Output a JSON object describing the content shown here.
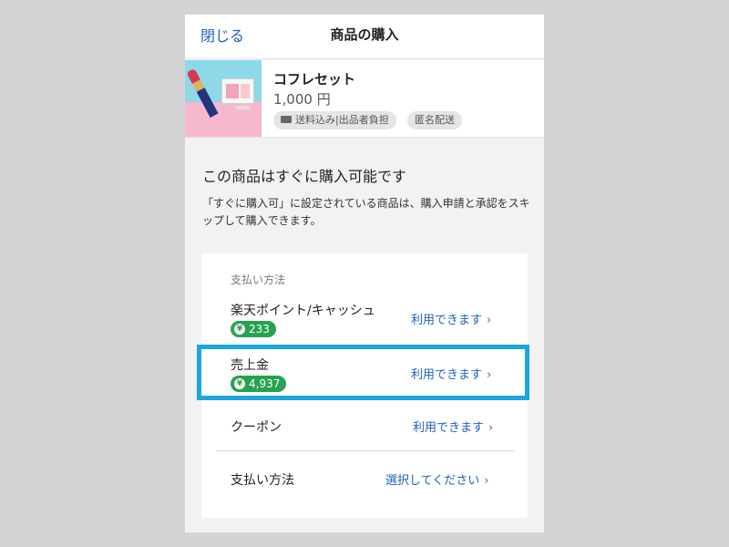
{
  "header": {
    "close_label": "閉じる",
    "title": "商品の購入"
  },
  "product": {
    "name": "コフレセット",
    "price": "1,000 円",
    "tags": [
      "送料込み|出品者負担",
      "匿名配送"
    ]
  },
  "info": {
    "title": "この商品はすぐに購入可能です",
    "description": "「すぐに購入可」に設定されている商品は、購入申請と承認をスキップして購入できます。"
  },
  "payment": {
    "heading": "支払い方法",
    "rows": [
      {
        "label": "楽天ポイント/キャッシュ",
        "badge": "233",
        "link": "利用できます"
      },
      {
        "label": "売上金",
        "badge": "4,937",
        "link": "利用できます"
      },
      {
        "label": "クーポン",
        "link": "利用できます"
      },
      {
        "label": "支払い方法",
        "link": "選択してください"
      }
    ],
    "chevron": "›",
    "yen_glyph": "¥"
  },
  "colors": {
    "accent": "#1f5fbf",
    "badge": "#27a251",
    "highlight": "#1aa7e0"
  },
  "icons": [
    "truck-icon",
    "yen-icon",
    "chevron-right-icon"
  ]
}
